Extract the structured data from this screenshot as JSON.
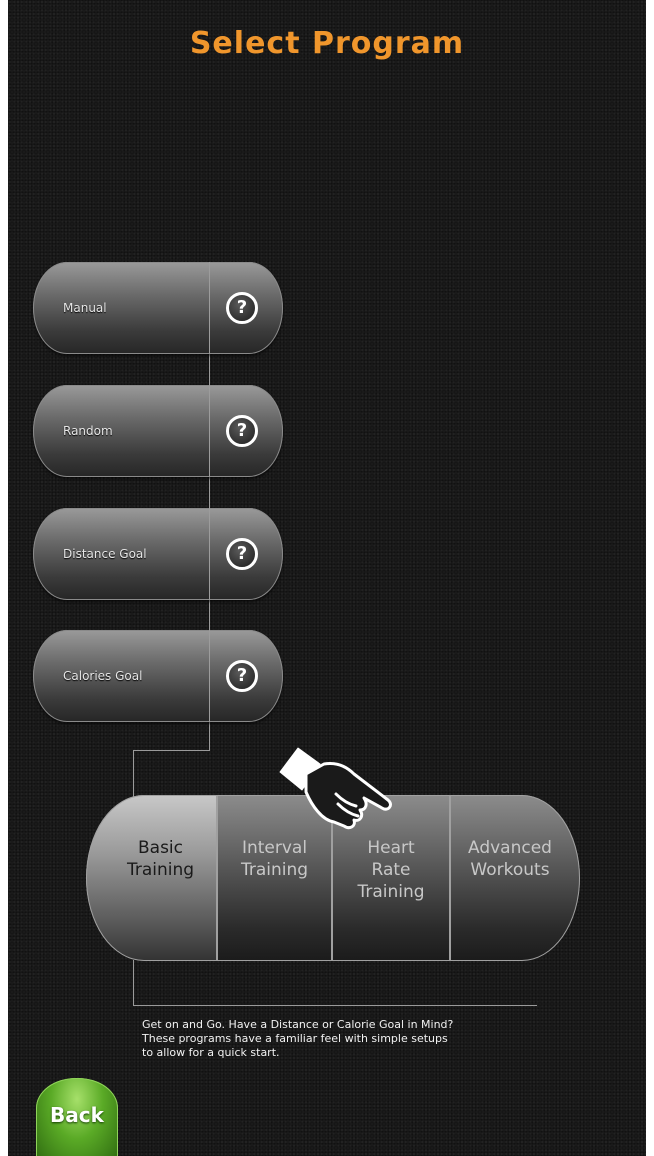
{
  "page_title": "Select Program",
  "programs": [
    {
      "label": "Manual",
      "help": "?"
    },
    {
      "label": "Random",
      "help": "?"
    },
    {
      "label": "Distance Goal",
      "help": "?"
    },
    {
      "label": "Calories Goal",
      "help": "?"
    }
  ],
  "categories": [
    {
      "label": "Basic\nTraining",
      "selected": true
    },
    {
      "label": "Interval\nTraining",
      "selected": false
    },
    {
      "label": "Heart\nRate\nTraining",
      "selected": false
    },
    {
      "label": "Advanced\nWorkouts",
      "selected": false
    }
  ],
  "description": "Get on and Go. Have a Distance or Calorie Goal in Mind?\nThese programs have a familiar feel with simple setups\nto allow for a quick start.",
  "back_label": "Back",
  "colors": {
    "title": "#f0962c",
    "back_button": "#5aaa26",
    "background": "#1a1a1a"
  },
  "icons": {
    "help": "question-mark-icon",
    "pointer": "pointing-hand-icon"
  }
}
